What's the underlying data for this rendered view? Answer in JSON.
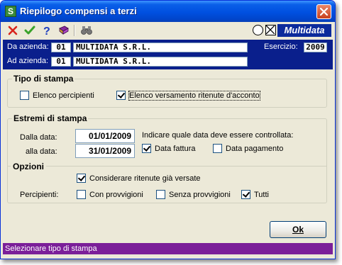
{
  "window": {
    "title": "Riepilogo compensi a terzi",
    "app_icon_letter": "S"
  },
  "toolbar": {
    "buttons": [
      "close-x-icon",
      "confirm-check-icon",
      "help-question-icon",
      "book-icon",
      "binoculars-icon"
    ],
    "logo_text": "Multidata"
  },
  "header": {
    "da_azienda_label": "Da azienda:",
    "da_azienda_code": "01",
    "da_azienda_name": "MULTIDATA S.R.L.",
    "ad_azienda_label": "Ad azienda:",
    "ad_azienda_code": "01",
    "ad_azienda_name": "MULTIDATA S.R.L.",
    "esercizio_label": "Esercizio:",
    "esercizio_value": "2009"
  },
  "tipo_stampa": {
    "title": "Tipo di stampa",
    "option1_label": "Elenco percipienti",
    "option1_checked": false,
    "option2_label": "Elenco versamento ritenute d'acconto",
    "option2_checked": true
  },
  "estremi": {
    "title": "Estremi di stampa",
    "dalla_label": "Dalla data:",
    "dalla_value": "01/01/2009",
    "alla_label": "alla data:",
    "alla_value": "31/01/2009",
    "indicare_label": "Indicare quale data deve essere controllata:",
    "data_fattura_label": "Data fattura",
    "data_fattura_checked": true,
    "data_pagamento_label": "Data pagamento",
    "data_pagamento_checked": false
  },
  "opzioni": {
    "title": "Opzioni",
    "considerare_label": "Considerare ritenute già versate",
    "considerare_checked": true,
    "percipienti_label": "Percipienti:",
    "con_label": "Con provvigioni",
    "con_checked": false,
    "senza_label": "Senza provvigioni",
    "senza_checked": false,
    "tutti_label": "Tutti",
    "tutti_checked": true
  },
  "ok_label": "Ok",
  "status_text": "Selezionare tipo di stampa",
  "colors": {
    "titlebar": "#0A5FE8",
    "header_band": "#0A1F8C",
    "status_bar": "#7B1F99",
    "dialog_bg": "#ECE9D8"
  }
}
